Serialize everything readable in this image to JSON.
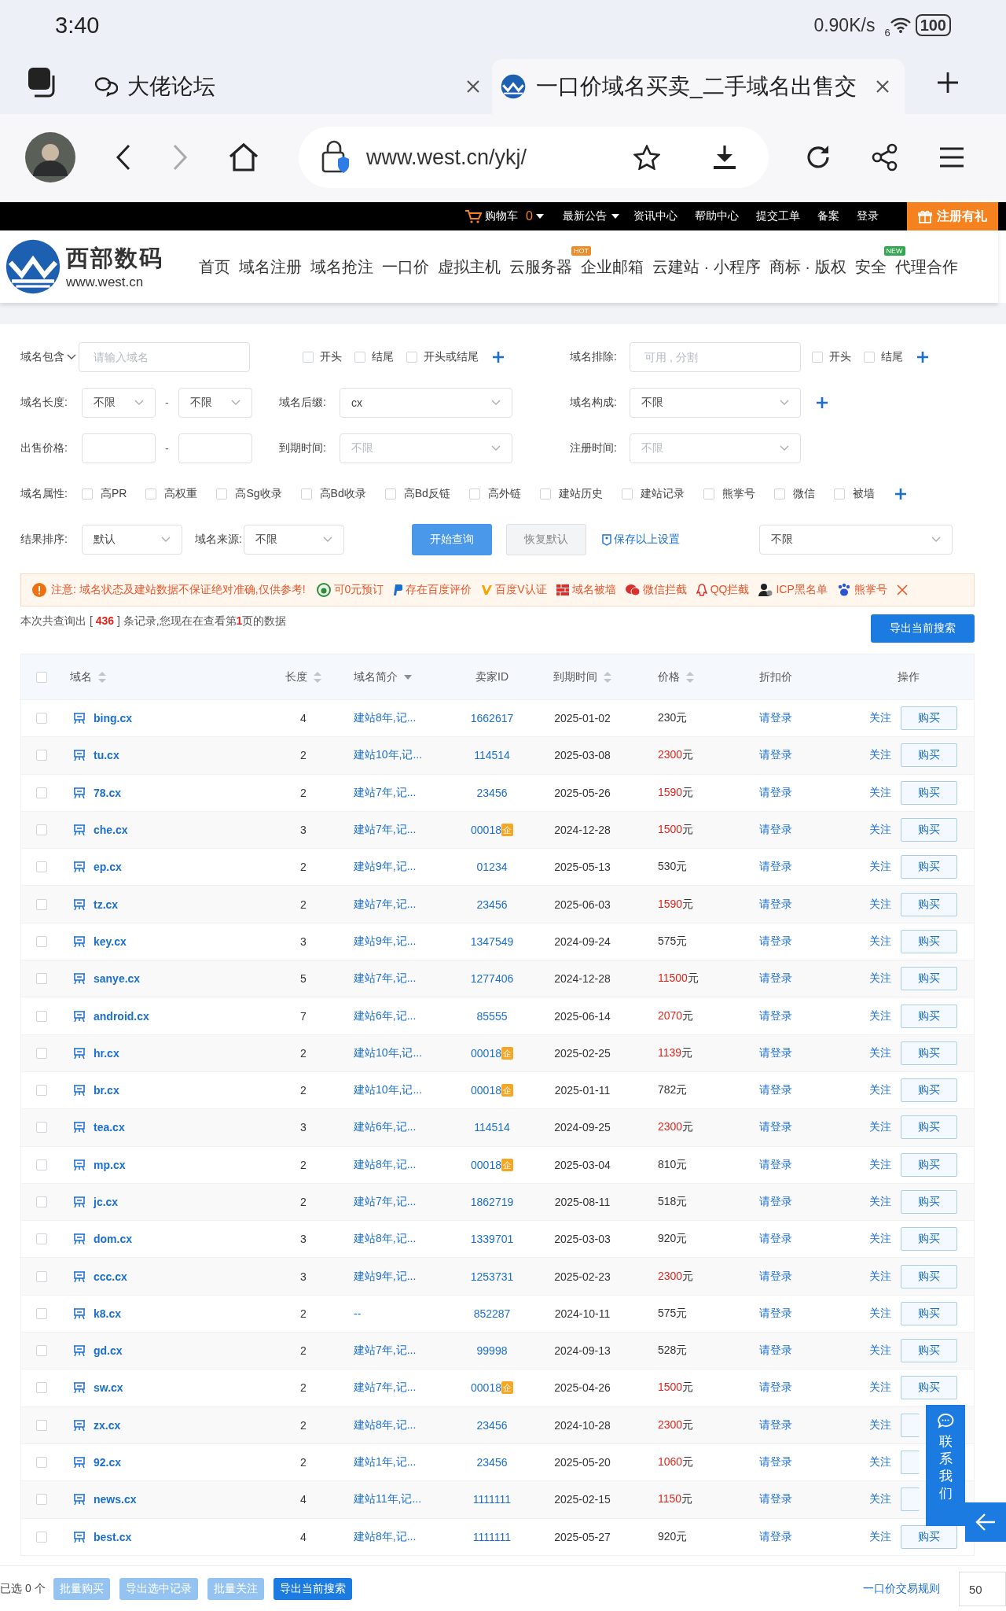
{
  "status_bar": {
    "time": "3:40",
    "speed": "0.90K/s",
    "network_gen": "6",
    "battery": "100"
  },
  "browser_tabs": [
    {
      "title": "大佬论坛",
      "kind": "chat",
      "selected": false
    },
    {
      "title": "一口价域名买卖_二手域名出售交",
      "kind": "site",
      "selected": true
    }
  ],
  "address_bar": {
    "url": "www.west.cn/ykj/"
  },
  "site_topbar": {
    "cart": "购物车",
    "cart_count": "0",
    "links": [
      {
        "label": "最新公告",
        "dropdown": true
      },
      {
        "label": "资讯中心",
        "dropdown": false
      },
      {
        "label": "帮助中心",
        "dropdown": false
      },
      {
        "label": "提交工单",
        "dropdown": false
      },
      {
        "label": "备案",
        "dropdown": false
      },
      {
        "label": "登录",
        "dropdown": false
      }
    ],
    "register": "注册有礼"
  },
  "site_header": {
    "logo_name": "西部数码",
    "logo_url": "www.west.cn",
    "nav": [
      {
        "label": "首页"
      },
      {
        "label": "域名注册"
      },
      {
        "label": "域名抢注"
      },
      {
        "label": "一口价"
      },
      {
        "label": "虚拟主机"
      },
      {
        "label": "云服务器",
        "badge": "HOT",
        "kind": "hot"
      },
      {
        "label": "企业邮箱"
      },
      {
        "label": "云建站 · 小程序"
      },
      {
        "label": "商标 · 版权"
      },
      {
        "label": "安全",
        "badge": "NEW",
        "kind": "new"
      },
      {
        "label": "代理合作"
      }
    ]
  },
  "filters": {
    "include": {
      "label": "域名包含",
      "placeholder": "请输入域名",
      "options": [
        {
          "label": "开头",
          "checked": false
        },
        {
          "label": "结尾",
          "checked": false
        },
        {
          "label": "开头或结尾",
          "checked": false
        }
      ]
    },
    "exclude": {
      "label": "域名排除:",
      "placeholder": "可用 , 分割",
      "options": [
        {
          "label": "开头",
          "checked": false
        },
        {
          "label": "结尾",
          "checked": false
        }
      ]
    },
    "length": {
      "label": "域名长度:",
      "from": "不限",
      "separator": "-",
      "to": "不限"
    },
    "suffix": {
      "label": "域名后缀:",
      "value": "cx"
    },
    "composition": {
      "label": "域名构成:",
      "value": "不限"
    },
    "price": {
      "label": "出售价格:",
      "separator": "-"
    },
    "expiry": {
      "label": "到期时间:",
      "placeholder": "不限"
    },
    "registered": {
      "label": "注册时间:",
      "placeholder": "不限"
    },
    "attributes": {
      "label": "域名属性:",
      "options": [
        {
          "label": "高PR",
          "checked": false
        },
        {
          "label": "高权重",
          "checked": false
        },
        {
          "label": "高Sg收录",
          "checked": false
        },
        {
          "label": "高Bd收录",
          "checked": false
        },
        {
          "label": "高Bd反链",
          "checked": false
        },
        {
          "label": "高外链",
          "checked": false
        },
        {
          "label": "建站历史",
          "checked": false
        },
        {
          "label": "建站记录",
          "checked": false
        },
        {
          "label": "熊掌号",
          "checked": false
        },
        {
          "label": "微信",
          "checked": false
        },
        {
          "label": "被墙",
          "checked": false
        }
      ]
    },
    "sort": {
      "label": "结果排序:",
      "value": "默认"
    },
    "source": {
      "label": "域名来源:",
      "value": "不限"
    },
    "search_button": "开始查询",
    "reset_button": "恢复默认",
    "save_link": "保存以上设置",
    "extra_select": "不限"
  },
  "notice": {
    "text": "注意:  域名状态及建站数据不保证绝对准确,仅供参考!",
    "legend": [
      {
        "label": "可0元预订",
        "kind": "rabbit"
      },
      {
        "label": "存在百度评价",
        "kind": "p"
      },
      {
        "label": "百度V认证",
        "kind": "v"
      },
      {
        "label": "域名被墙",
        "kind": "wall"
      },
      {
        "label": "微信拦截",
        "kind": "wechat"
      },
      {
        "label": "QQ拦截",
        "kind": "qq"
      },
      {
        "label": "ICP黑名单",
        "kind": "person"
      },
      {
        "label": "熊掌号",
        "kind": "paw"
      }
    ]
  },
  "summary": "本次共查询出 [ **436** ] 条记录,您现在在查看第**1**页的数据",
  "export_button": "导出当前搜索",
  "table": {
    "all_selected": false,
    "columns": [
      {
        "label": "域名",
        "kind": "sortable"
      },
      {
        "label": "长度",
        "kind": "sortable"
      },
      {
        "label": "域名简介",
        "kind": "dropdown"
      },
      {
        "label": "卖家ID",
        "kind": "plain"
      },
      {
        "label": "到期时间",
        "kind": "sortable"
      },
      {
        "label": "价格",
        "kind": "sortable"
      },
      {
        "label": "折扣价",
        "kind": "plain"
      },
      {
        "label": "操作",
        "kind": "plain"
      }
    ],
    "rows": [
      {
        "name": "bing.cx",
        "length": "4",
        "intro": "建站8年,记...",
        "seller": "1662617",
        "expiry": "2025-01-02",
        "price": "230",
        "unit": "元",
        "highlight": false,
        "discount": "请登录",
        "follow": "关注",
        "buy": "购买",
        "selected": false
      },
      {
        "name": "tu.cx",
        "length": "2",
        "intro": "建站10年,记...",
        "seller": "114514",
        "expiry": "2025-03-08",
        "price": "2300",
        "unit": "元",
        "highlight": true,
        "discount": "请登录",
        "follow": "关注",
        "buy": "购买",
        "selected": false
      },
      {
        "name": "78.cx",
        "length": "2",
        "intro": "建站7年,记...",
        "seller": "23456",
        "expiry": "2025-05-26",
        "price": "1590",
        "unit": "元",
        "highlight": true,
        "discount": "请登录",
        "follow": "关注",
        "buy": "购买",
        "selected": false
      },
      {
        "name": "che.cx",
        "length": "3",
        "intro": "建站7年,记...",
        "seller": "00018",
        "badge": "企",
        "expiry": "2024-12-28",
        "price": "1500",
        "unit": "元",
        "highlight": true,
        "discount": "请登录",
        "follow": "关注",
        "buy": "购买",
        "selected": false
      },
      {
        "name": "ep.cx",
        "length": "2",
        "intro": "建站9年,记...",
        "seller": "01234",
        "expiry": "2025-05-13",
        "price": "530",
        "unit": "元",
        "highlight": false,
        "discount": "请登录",
        "follow": "关注",
        "buy": "购买",
        "selected": false
      },
      {
        "name": "tz.cx",
        "length": "2",
        "intro": "建站7年,记...",
        "seller": "23456",
        "expiry": "2025-06-03",
        "price": "1590",
        "unit": "元",
        "highlight": true,
        "discount": "请登录",
        "follow": "关注",
        "buy": "购买",
        "selected": false
      },
      {
        "name": "key.cx",
        "length": "3",
        "intro": "建站9年,记...",
        "seller": "1347549",
        "expiry": "2024-09-24",
        "price": "575",
        "unit": "元",
        "highlight": false,
        "discount": "请登录",
        "follow": "关注",
        "buy": "购买",
        "selected": false
      },
      {
        "name": "sanye.cx",
        "length": "5",
        "intro": "建站7年,记...",
        "seller": "1277406",
        "expiry": "2024-12-28",
        "price": "11500",
        "unit": "元",
        "highlight": true,
        "discount": "请登录",
        "follow": "关注",
        "buy": "购买",
        "selected": false
      },
      {
        "name": "android.cx",
        "length": "7",
        "intro": "建站6年,记...",
        "seller": "85555",
        "expiry": "2025-06-14",
        "price": "2070",
        "unit": "元",
        "highlight": true,
        "discount": "请登录",
        "follow": "关注",
        "buy": "购买",
        "selected": false
      },
      {
        "name": "hr.cx",
        "length": "2",
        "intro": "建站10年,记...",
        "seller": "00018",
        "badge": "企",
        "expiry": "2025-02-25",
        "price": "1139",
        "unit": "元",
        "highlight": true,
        "discount": "请登录",
        "follow": "关注",
        "buy": "购买",
        "selected": false
      },
      {
        "name": "br.cx",
        "length": "2",
        "intro": "建站10年,记...",
        "seller": "00018",
        "badge": "企",
        "expiry": "2025-01-11",
        "price": "782",
        "unit": "元",
        "highlight": false,
        "discount": "请登录",
        "follow": "关注",
        "buy": "购买",
        "selected": false
      },
      {
        "name": "tea.cx",
        "length": "3",
        "intro": "建站6年,记...",
        "seller": "114514",
        "expiry": "2024-09-25",
        "price": "2300",
        "unit": "元",
        "highlight": true,
        "discount": "请登录",
        "follow": "关注",
        "buy": "购买",
        "selected": false
      },
      {
        "name": "mp.cx",
        "length": "2",
        "intro": "建站8年,记...",
        "seller": "00018",
        "badge": "企",
        "expiry": "2025-03-04",
        "price": "810",
        "unit": "元",
        "highlight": false,
        "discount": "请登录",
        "follow": "关注",
        "buy": "购买",
        "selected": false
      },
      {
        "name": "jc.cx",
        "length": "2",
        "intro": "建站7年,记...",
        "seller": "1862719",
        "expiry": "2025-08-11",
        "price": "518",
        "unit": "元",
        "highlight": false,
        "discount": "请登录",
        "follow": "关注",
        "buy": "购买",
        "selected": false
      },
      {
        "name": "dom.cx",
        "length": "3",
        "intro": "建站8年,记...",
        "seller": "1339701",
        "expiry": "2025-03-03",
        "price": "920",
        "unit": "元",
        "highlight": false,
        "discount": "请登录",
        "follow": "关注",
        "buy": "购买",
        "selected": false
      },
      {
        "name": "ccc.cx",
        "length": "3",
        "intro": "建站9年,记...",
        "seller": "1253731",
        "expiry": "2025-02-23",
        "price": "2300",
        "unit": "元",
        "highlight": true,
        "discount": "请登录",
        "follow": "关注",
        "buy": "购买",
        "selected": false
      },
      {
        "name": "k8.cx",
        "length": "2",
        "intro": "--",
        "seller": "852287",
        "expiry": "2024-10-11",
        "price": "575",
        "unit": "元",
        "highlight": false,
        "discount": "请登录",
        "follow": "关注",
        "buy": "购买",
        "selected": false
      },
      {
        "name": "gd.cx",
        "length": "2",
        "intro": "建站7年,记...",
        "seller": "99998",
        "expiry": "2024-09-13",
        "price": "528",
        "unit": "元",
        "highlight": false,
        "discount": "请登录",
        "follow": "关注",
        "buy": "购买",
        "selected": false
      },
      {
        "name": "sw.cx",
        "length": "2",
        "intro": "建站7年,记...",
        "seller": "00018",
        "badge": "企",
        "expiry": "2025-04-26",
        "price": "1500",
        "unit": "元",
        "highlight": true,
        "discount": "请登录",
        "follow": "关注",
        "buy": "购买",
        "selected": false
      },
      {
        "name": "zx.cx",
        "length": "2",
        "intro": "建站8年,记...",
        "seller": "23456",
        "expiry": "2024-10-28",
        "price": "2300",
        "unit": "元",
        "highlight": true,
        "discount": "请登录",
        "follow": "关注",
        "selected": false
      },
      {
        "name": "92.cx",
        "length": "2",
        "intro": "建站1年,记...",
        "seller": "23456",
        "expiry": "2025-05-20",
        "price": "1060",
        "unit": "元",
        "highlight": true,
        "discount": "请登录",
        "follow": "关注",
        "selected": false
      },
      {
        "name": "news.cx",
        "length": "4",
        "intro": "建站11年,记...",
        "seller": "1111111",
        "expiry": "2025-02-15",
        "price": "1150",
        "unit": "元",
        "highlight": true,
        "discount": "请登录",
        "follow": "关注",
        "selected": false
      },
      {
        "name": "best.cx",
        "length": "4",
        "intro": "建站8年,记...",
        "seller": "1111111",
        "expiry": "2025-05-27",
        "price": "920",
        "unit": "元",
        "highlight": false,
        "discount": "请登录",
        "follow": "关注",
        "buy": "购买",
        "selected": false
      }
    ]
  },
  "footer": {
    "selected_count": "已选 0 个",
    "buttons": [
      {
        "label": "批量购买",
        "disabled": true
      },
      {
        "label": "导出选中记录",
        "disabled": true
      },
      {
        "label": "批量关注",
        "disabled": true
      },
      {
        "label": "导出当前搜索",
        "disabled": false
      }
    ],
    "rules_link": "一口价交易规则",
    "page_size": "50"
  },
  "contact_widget": {
    "label": "联系我们"
  }
}
